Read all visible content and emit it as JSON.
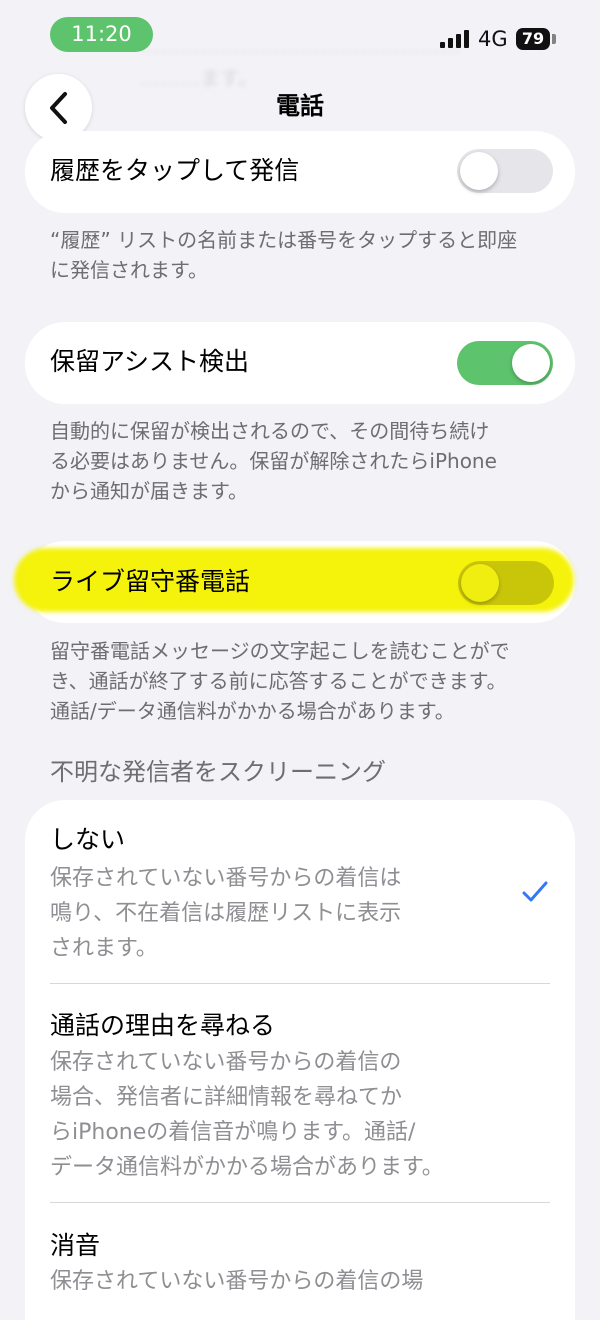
{
  "status_bar": {
    "time": "11:20",
    "network": "4G",
    "battery": "79",
    "time_pill_color": "#5dc36d"
  },
  "background_text": "…………………………………………\n………ます。",
  "nav": {
    "title": "電話",
    "back_icon": "chevron-left-icon"
  },
  "settings": [
    {
      "label": "履歴をタップして発信",
      "toggle_on": false,
      "description": "“履歴” リストの名前または番号をタップすると即座\nに発信されます。"
    },
    {
      "label": "保留アシスト検出",
      "toggle_on": true,
      "description": "自動的に保留が検出されるので、その間待ち続け\nる必要はありません。保留が解除されたらiPhone\nから通知が届きます。"
    },
    {
      "label": "ライブ留守番電話",
      "toggle_on": false,
      "highlighted": true,
      "description": "留守番電話メッセージの文字起こしを読むことがで\nき、通話が終了する前に応答することができます。\n通話/データ通信料がかかる場合があります。"
    }
  ],
  "screening": {
    "header": "不明な発信者をスクリーニング",
    "options": [
      {
        "title": "しない",
        "subtitle": "保存されていない番号からの着信は\n鳴り、不在着信は履歴リストに表示\nされます。",
        "selected": true
      },
      {
        "title": "通話の理由を尋ねる",
        "subtitle": "保存されていない番号からの着信の\n場合、発信者に詳細情報を尋ねてか\nらiPhoneの着信音が鳴ります。通話/\nデータ通信料がかかる場合があります。",
        "selected": false
      },
      {
        "title": "消音",
        "subtitle": "保存されていない番号からの着信の場",
        "selected": false
      }
    ]
  },
  "colors": {
    "accent": "#3478f6",
    "toggle_on": "#5dc36d",
    "highlight": "#f5f200",
    "background": "#f2f2f7"
  }
}
